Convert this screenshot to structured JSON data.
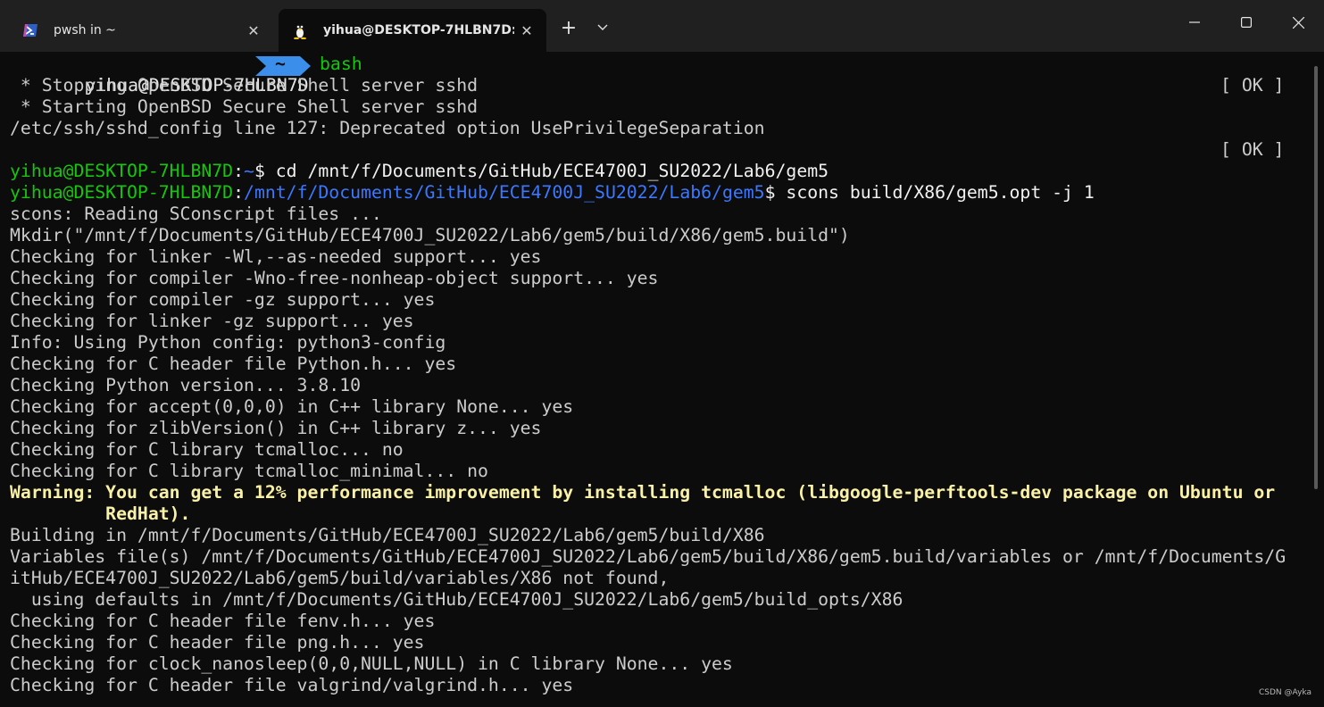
{
  "tabs": [
    {
      "label": "pwsh in ~",
      "icon": "powershell-icon",
      "close": "✕"
    },
    {
      "label": "yihua@DESKTOP-7HLBN7D: /",
      "icon": "linux-penguin-icon",
      "close": "✕"
    }
  ],
  "titlebar": {
    "new_tab": "+",
    "dropdown": "⌄"
  },
  "window_controls": {
    "minimize": "—",
    "maximize": "☐",
    "close": "✕"
  },
  "prompt_segment": {
    "user": "yihua@DESKTOP-7HLBN7D",
    "dir": "~",
    "shell": "bash"
  },
  "lines": {
    "l2": " * Stopping OpenBSD Secure Shell server sshd",
    "l3": " * Starting OpenBSD Secure Shell server sshd",
    "l4": "/etc/ssh/sshd_config line 127: Deprecated option UsePrivilegeSeparation",
    "ok": "[ OK ]",
    "p1_user": "yihua@DESKTOP-7HLBN7D",
    "p1_sep": ":",
    "p1_dir": "~",
    "p1_cmd": "$ cd /mnt/f/Documents/GitHub/ECE4700J_SU2022/Lab6/gem5",
    "p2_user": "yihua@DESKTOP-7HLBN7D",
    "p2_sep": ":",
    "p2_dir": "/mnt/f/Documents/GitHub/ECE4700J_SU2022/Lab6/gem5",
    "p2_cmd": "$ scons build/X86/gem5.opt -j 1",
    "l8": "scons: Reading SConscript files ...",
    "l9": "Mkdir(\"/mnt/f/Documents/GitHub/ECE4700J_SU2022/Lab6/gem5/build/X86/gem5.build\")",
    "l10": "Checking for linker -Wl,--as-needed support... yes",
    "l11": "Checking for compiler -Wno-free-nonheap-object support... yes",
    "l12": "Checking for compiler -gz support... yes",
    "l13": "Checking for linker -gz support... yes",
    "l14": "Info: Using Python config: python3-config",
    "l15": "Checking for C header file Python.h... yes",
    "l16": "Checking Python version... 3.8.10",
    "l17": "Checking for accept(0,0,0) in C++ library None... yes",
    "l18": "Checking for zlibVersion() in C++ library z... yes",
    "l19": "Checking for C library tcmalloc... no",
    "l20": "Checking for C library tcmalloc_minimal... no",
    "l21": "Warning: You can get a 12% performance improvement by installing tcmalloc (libgoogle-perftools-dev package on Ubuntu or",
    "l22": "         RedHat).",
    "l23": "Building in /mnt/f/Documents/GitHub/ECE4700J_SU2022/Lab6/gem5/build/X86",
    "l24": "Variables file(s) /mnt/f/Documents/GitHub/ECE4700J_SU2022/Lab6/gem5/build/X86/gem5.build/variables or /mnt/f/Documents/G",
    "l25": "itHub/ECE4700J_SU2022/Lab6/gem5/build/variables/X86 not found,",
    "l26": "  using defaults in /mnt/f/Documents/GitHub/ECE4700J_SU2022/Lab6/gem5/build_opts/X86",
    "l27": "Checking for C header file fenv.h... yes",
    "l28": "Checking for C header file png.h... yes",
    "l29": "Checking for clock_nanosleep(0,0,NULL,NULL) in C library None... yes",
    "l30": "Checking for C header file valgrind/valgrind.h... yes"
  },
  "watermark": "CSDN @Ayka",
  "colors": {
    "background": "#0c0c0c",
    "titlebar": "#202020",
    "green": "#16c60c",
    "blue": "#3b78ff",
    "yellow": "#f9f1a5",
    "segment_blue": "#3b8eea"
  }
}
